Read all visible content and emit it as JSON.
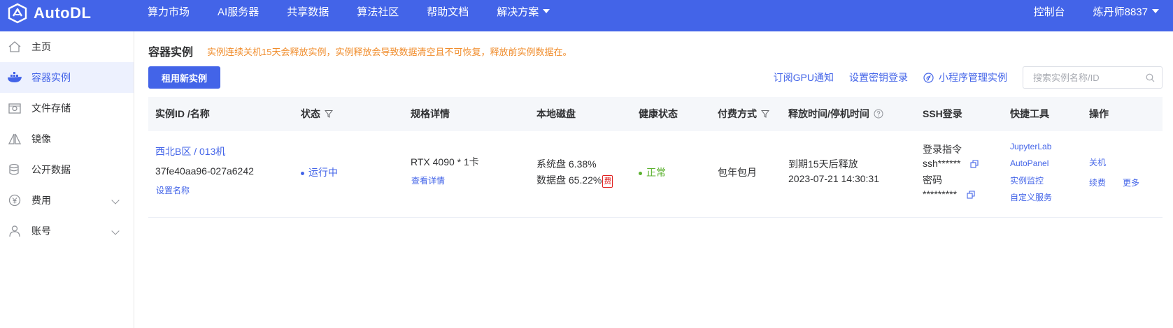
{
  "app": {
    "logo_text": "AutoDL"
  },
  "nav": {
    "items": [
      "算力市场",
      "AI服务器",
      "共享数据",
      "算法社区",
      "帮助文档",
      "解决方案"
    ],
    "console": "控制台",
    "user": "炼丹师8837"
  },
  "sidebar": {
    "items": [
      {
        "label": "主页",
        "icon": "home-icon"
      },
      {
        "label": "容器实例",
        "icon": "container-icon",
        "active": true
      },
      {
        "label": "文件存储",
        "icon": "storage-icon"
      },
      {
        "label": "镜像",
        "icon": "image-icon"
      },
      {
        "label": "公开数据",
        "icon": "database-icon"
      },
      {
        "label": "费用",
        "icon": "yuan-icon",
        "expandable": true
      },
      {
        "label": "账号",
        "icon": "user-icon",
        "expandable": true
      }
    ]
  },
  "main": {
    "title": "容器实例",
    "warning": "实例连续关机15天会释放实例，实例释放会导致数据清空且不可恢复，释放前实例数据在。",
    "rent_button": "租用新实例",
    "toolbar": {
      "subscribe_gpu": "订阅GPU通知",
      "set_key_login": "设置密钥登录",
      "mini_program": "小程序管理实例",
      "search_placeholder": "搜索实例名称/ID"
    },
    "table": {
      "headers": {
        "id_name": "实例ID /名称",
        "status": "状态",
        "spec": "规格详情",
        "disk": "本地磁盘",
        "health": "健康状态",
        "billing": "付费方式",
        "release_time": "释放时间/停机时间",
        "ssh": "SSH登录",
        "tools": "快捷工具",
        "actions": "操作"
      },
      "row": {
        "region_name": "西北B区 / 013机",
        "instance_id": "37fe40aa96-027a6242",
        "set_name": "设置名称",
        "status": "运行中",
        "gpu_spec": "RTX 4090 * 1卡",
        "view_details": "查看详情",
        "system_disk": "系统盘 6.38%",
        "data_disk": "数据盘 65.22%",
        "fee_badge": "费",
        "health": "正常",
        "billing": "包年包月",
        "release_line1": "到期15天后释放",
        "release_line2": "2023-07-21 14:30:31",
        "ssh_cmd_label": "登录指令",
        "ssh_cmd": "ssh******",
        "ssh_pwd_label": "密码",
        "ssh_pwd": "*********",
        "tools": [
          "JupyterLab",
          "AutoPanel",
          "实例监控",
          "自定义服务"
        ],
        "actions": {
          "shutdown": "关机",
          "renew": "续费",
          "more": "更多"
        }
      }
    }
  },
  "colors": {
    "brand": "#4364e8",
    "warning": "#f08c2b",
    "success": "#5bb12f",
    "danger": "#e02020"
  }
}
